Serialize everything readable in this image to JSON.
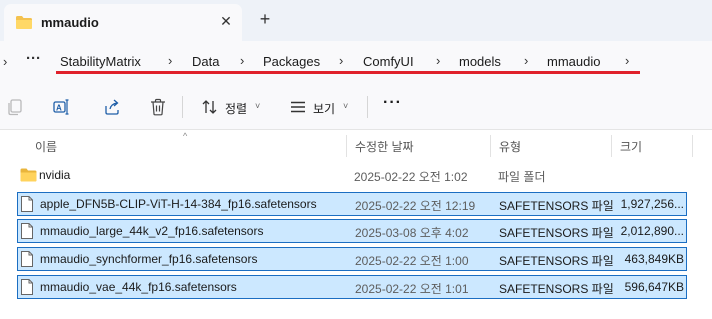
{
  "tab": {
    "title": "mmaudio",
    "close_glyph": "✕",
    "new_glyph": "+"
  },
  "address": {
    "nav_glyph": "›",
    "overflow_glyph": "···",
    "crumbs": [
      "StabilityMatrix",
      "Data",
      "Packages",
      "ComfyUI",
      "models",
      "mmaudio"
    ],
    "sep_glyph": "›"
  },
  "toolbar": {
    "sort_label": "정렬",
    "view_label": "보기",
    "more_glyph": "···",
    "caret_glyph": "˅"
  },
  "columns": {
    "name": "이름",
    "date": "수정한 날짜",
    "type": "유형",
    "size": "크기",
    "sort_glyph": "^"
  },
  "rows": [
    {
      "name": "nvidia",
      "date": "2025-02-22 오전 1:02",
      "type": "파일 폴더",
      "size": "",
      "kind": "folder",
      "selected": false
    },
    {
      "name": "apple_DFN5B-CLIP-ViT-H-14-384_fp16.safetensors",
      "date": "2025-02-22 오전 12:19",
      "type": "SAFETENSORS 파일",
      "size": "1,927,256...",
      "kind": "file",
      "selected": true
    },
    {
      "name": "mmaudio_large_44k_v2_fp16.safetensors",
      "date": "2025-03-08 오후 4:02",
      "type": "SAFETENSORS 파일",
      "size": "2,012,890...",
      "kind": "file",
      "selected": true
    },
    {
      "name": "mmaudio_synchformer_fp16.safetensors",
      "date": "2025-02-22 오전 1:00",
      "type": "SAFETENSORS 파일",
      "size": "463,849KB",
      "kind": "file",
      "selected": true
    },
    {
      "name": "mmaudio_vae_44k_fp16.safetensors",
      "date": "2025-02-22 오전 1:01",
      "type": "SAFETENSORS 파일",
      "size": "596,647KB",
      "kind": "file",
      "selected": true
    }
  ],
  "colors": {
    "accent": "#1b6ec2",
    "selection": "#cce8ff",
    "annotation_red": "#e0212b",
    "folder": "#f4c24f"
  }
}
